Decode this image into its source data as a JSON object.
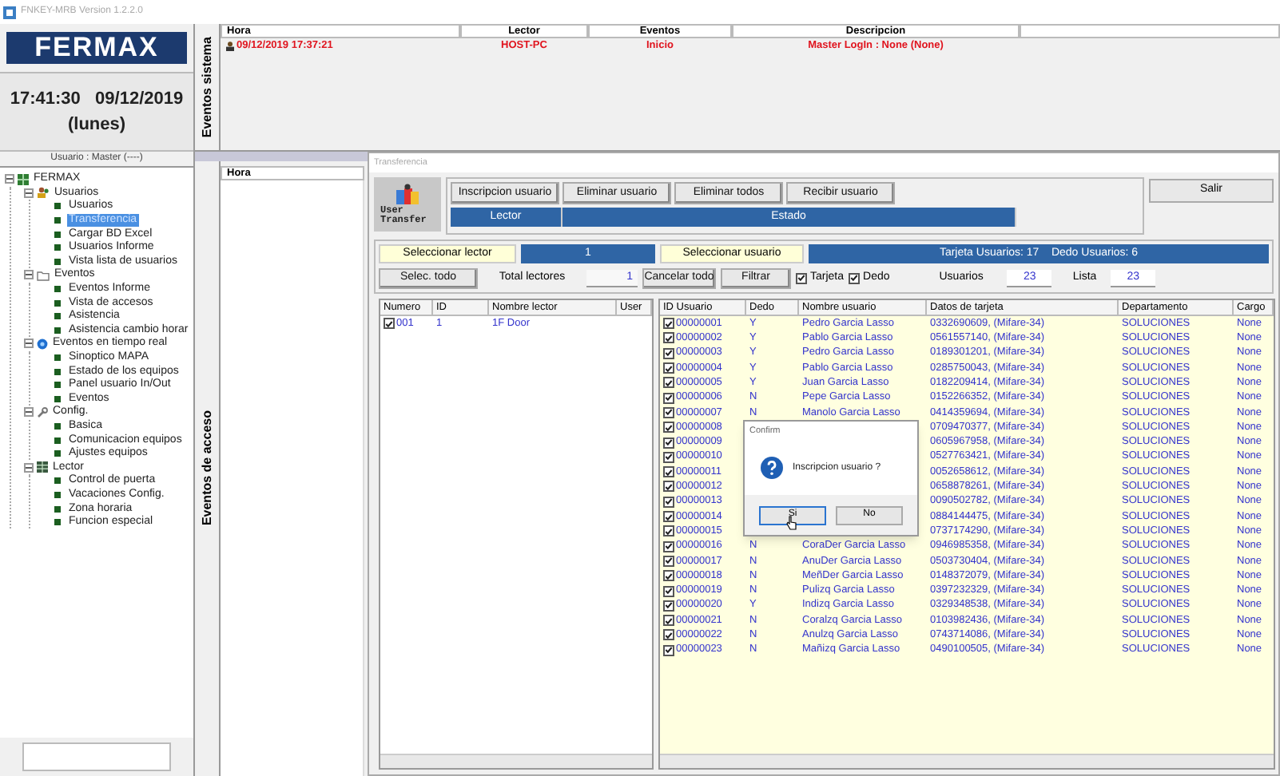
{
  "window": {
    "title": "FNKEY-MRB Version 1.2.2.0"
  },
  "sidebar": {
    "logo": "FERMAX",
    "clock": "17:41:30   09/12/2019",
    "day": "(lunes)",
    "user": "Usuario : Master (----)",
    "tree": {
      "label": "FERMAX",
      "kind": "root",
      "expanded": true,
      "selected": false,
      "children": [
        {
          "label": "Usuarios",
          "kind": "users",
          "expanded": true,
          "selected": false,
          "children": [
            {
              "label": "Usuarios",
              "kind": "item",
              "selected": false
            },
            {
              "label": "Transferencia",
              "kind": "item",
              "selected": true
            },
            {
              "label": "Cargar BD Excel",
              "kind": "item",
              "selected": false
            },
            {
              "label": "Usuarios Informe",
              "kind": "item",
              "selected": false
            },
            {
              "label": "Vista lista de usuarios",
              "kind": "item",
              "selected": false
            }
          ]
        },
        {
          "label": "Eventos",
          "kind": "folder",
          "expanded": true,
          "selected": false,
          "children": [
            {
              "label": "Eventos Informe",
              "kind": "item",
              "selected": false
            },
            {
              "label": "Vista de accesos",
              "kind": "item",
              "selected": false
            },
            {
              "label": "Asistencia",
              "kind": "item",
              "selected": false
            },
            {
              "label": "Asistencia cambio horar",
              "kind": "item",
              "selected": false
            }
          ]
        },
        {
          "label": "Eventos en tiempo real",
          "kind": "realtime",
          "expanded": true,
          "selected": false,
          "children": [
            {
              "label": "Sinoptico MAPA",
              "kind": "item",
              "selected": false
            },
            {
              "label": "Estado de los equipos",
              "kind": "item",
              "selected": false
            },
            {
              "label": "Panel usuario In/Out",
              "kind": "item",
              "selected": false
            },
            {
              "label": "Eventos",
              "kind": "item",
              "selected": false
            }
          ]
        },
        {
          "label": "Config.",
          "kind": "config",
          "expanded": true,
          "selected": false,
          "children": [
            {
              "label": "Basica",
              "kind": "item",
              "selected": false
            },
            {
              "label": "Comunicacion equipos",
              "kind": "item",
              "selected": false
            },
            {
              "label": "Ajustes equipos",
              "kind": "item",
              "selected": false
            }
          ]
        },
        {
          "label": "Lector",
          "kind": "reader",
          "expanded": true,
          "selected": false,
          "children": [
            {
              "label": "Control de puerta",
              "kind": "item",
              "selected": false
            },
            {
              "label": "Vacaciones Config.",
              "kind": "item",
              "selected": false
            },
            {
              "label": "Zona horaria",
              "kind": "item",
              "selected": false
            },
            {
              "label": "Funcion especial",
              "kind": "item",
              "selected": false
            }
          ]
        }
      ]
    }
  },
  "system_events": {
    "label": "Eventos sistema",
    "columns": [
      "Hora",
      "Lector",
      "Eventos",
      "Descripcion"
    ],
    "rows": [
      [
        "09/12/2019 17:37:21",
        "HOST-PC",
        "Inicio",
        "Master LogIn : None (None)"
      ]
    ]
  },
  "access_events": {
    "label": "Eventos de acceso",
    "columns": [
      "Hora"
    ]
  },
  "transfer": {
    "title": "Transferencia",
    "logo_text": "User Transfer",
    "buttons": [
      "Inscripcion usuario",
      "Eliminar usuario",
      "Eliminar todos",
      "Recibir usuario"
    ],
    "status_columns": [
      "Lector",
      "Estado"
    ],
    "exit": "Salir",
    "select_reader": "Seleccionar lector",
    "reader_count": "1",
    "select_user": "Seleccionar usuario",
    "user_summary": "Tarjeta Usuarios: 17    Dedo Usuarios: 6",
    "select_all": "Selec. todo",
    "total_readers_label": "Total lectores",
    "total_readers": "1",
    "cancel_all": "Cancelar todo",
    "filter": "Filtrar",
    "filters": [
      {
        "label": "Tarjeta",
        "checked": true
      },
      {
        "label": "Dedo",
        "checked": true
      }
    ],
    "users_label": "Usuarios",
    "users": "23",
    "list_label": "Lista",
    "list": "23",
    "reader_columns": [
      "Numero",
      "ID",
      "Nombre lector",
      "User"
    ],
    "readers": [
      {
        "checked": true,
        "cells": [
          "001",
          "1",
          "1F Door"
        ]
      }
    ],
    "user_columns": [
      "ID Usuario",
      "Dedo",
      "Nombre usuario",
      "Datos de tarjeta",
      "Departamento",
      "Cargo"
    ],
    "users_rows": [
      {
        "checked": true,
        "id": "00000001",
        "dedo": "Y",
        "name": "Pedro Garcia Lasso",
        "card": "0332690609, (Mifare-34)",
        "dept": "SOLUCIONES",
        "cargo": "None"
      },
      {
        "checked": true,
        "id": "00000002",
        "dedo": "Y",
        "name": "Pablo Garcia Lasso",
        "card": "0561557140, (Mifare-34)",
        "dept": "SOLUCIONES",
        "cargo": "None"
      },
      {
        "checked": true,
        "id": "00000003",
        "dedo": "Y",
        "name": "Pedro Garcia Lasso",
        "card": "0189301201, (Mifare-34)",
        "dept": "SOLUCIONES",
        "cargo": "None"
      },
      {
        "checked": true,
        "id": "00000004",
        "dedo": "Y",
        "name": "Pablo Garcia Lasso",
        "card": "0285750043, (Mifare-34)",
        "dept": "SOLUCIONES",
        "cargo": "None"
      },
      {
        "checked": true,
        "id": "00000005",
        "dedo": "Y",
        "name": "Juan Garcia Lasso",
        "card": "0182209414, (Mifare-34)",
        "dept": "SOLUCIONES",
        "cargo": "None"
      },
      {
        "checked": true,
        "id": "00000006",
        "dedo": "N",
        "name": "Pepe Garcia Lasso",
        "card": "0152266352, (Mifare-34)",
        "dept": "SOLUCIONES",
        "cargo": "None"
      },
      {
        "checked": true,
        "id": "00000007",
        "dedo": "N",
        "name": "Manolo Garcia Lasso",
        "card": "0414359694, (Mifare-34)",
        "dept": "SOLUCIONES",
        "cargo": "None"
      },
      {
        "checked": true,
        "id": "00000008",
        "card": "0709470377, (Mifare-34)",
        "dept": "SOLUCIONES",
        "cargo": "None"
      },
      {
        "checked": true,
        "id": "00000009",
        "card": "0605967958, (Mifare-34)",
        "dept": "SOLUCIONES",
        "cargo": "None"
      },
      {
        "checked": true,
        "id": "00000010",
        "card": "0527763421, (Mifare-34)",
        "dept": "SOLUCIONES",
        "cargo": "None"
      },
      {
        "checked": true,
        "id": "00000011",
        "card": "0052658612, (Mifare-34)",
        "dept": "SOLUCIONES",
        "cargo": "None"
      },
      {
        "checked": true,
        "id": "00000012",
        "card": "0658878261, (Mifare-34)",
        "dept": "SOLUCIONES",
        "cargo": "None"
      },
      {
        "checked": true,
        "id": "00000013",
        "card": "0090502782, (Mifare-34)",
        "dept": "SOLUCIONES",
        "cargo": "None"
      },
      {
        "checked": true,
        "id": "00000014",
        "card": "0884144475, (Mifare-34)",
        "dept": "SOLUCIONES",
        "cargo": "None"
      },
      {
        "checked": true,
        "id": "00000015",
        "card": "0737174290, (Mifare-34)",
        "dept": "SOLUCIONES",
        "cargo": "None"
      },
      {
        "checked": true,
        "id": "00000016",
        "dedo": "N",
        "name": "CoraDer Garcia Lasso",
        "card": "0946985358, (Mifare-34)",
        "dept": "SOLUCIONES",
        "cargo": "None"
      },
      {
        "checked": true,
        "id": "00000017",
        "dedo": "N",
        "name": "AnuDer Garcia Lasso",
        "card": "0503730404, (Mifare-34)",
        "dept": "SOLUCIONES",
        "cargo": "None"
      },
      {
        "checked": true,
        "id": "00000018",
        "dedo": "N",
        "name": "MeñDer Garcia Lasso",
        "card": "0148372079, (Mifare-34)",
        "dept": "SOLUCIONES",
        "cargo": "None"
      },
      {
        "checked": true,
        "id": "00000019",
        "dedo": "N",
        "name": "Pulizq Garcia Lasso",
        "card": "0397232329, (Mifare-34)",
        "dept": "SOLUCIONES",
        "cargo": "None"
      },
      {
        "checked": true,
        "id": "00000020",
        "dedo": "Y",
        "name": "Indizq Garcia Lasso",
        "card": "0329348538, (Mifare-34)",
        "dept": "SOLUCIONES",
        "cargo": "None"
      },
      {
        "checked": true,
        "id": "00000021",
        "dedo": "N",
        "name": "Coralzq Garcia Lasso",
        "card": "0103982436, (Mifare-34)",
        "dept": "SOLUCIONES",
        "cargo": "None"
      },
      {
        "checked": true,
        "id": "00000022",
        "dedo": "N",
        "name": "Anulzq Garcia Lasso",
        "card": "0743714086, (Mifare-34)",
        "dept": "SOLUCIONES",
        "cargo": "None"
      },
      {
        "checked": true,
        "id": "00000023",
        "dedo": "N",
        "name": "Mañizq Garcia Lasso",
        "card": "0490100505, (Mifare-34)",
        "dept": "SOLUCIONES",
        "cargo": "None"
      }
    ]
  },
  "dialog": {
    "title": "Confirm",
    "message": "Inscripcion usuario ?",
    "buttons": [
      {
        "label": "Si",
        "focused": true
      },
      {
        "label": "No",
        "focused": false
      }
    ]
  }
}
